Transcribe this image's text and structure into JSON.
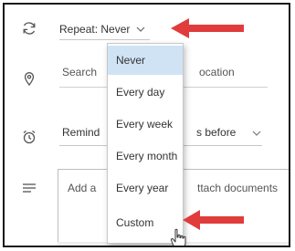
{
  "repeat": {
    "label": "Repeat: Never",
    "icon": "repeat-icon"
  },
  "location": {
    "left_text": "Search",
    "right_text": "ocation",
    "icon": "location-pin-icon"
  },
  "reminder": {
    "left_text": "Remind",
    "right_text": "s before",
    "icon": "alarm-clock-icon"
  },
  "notes": {
    "left_text": "Add a",
    "right_text": "ttach documents",
    "icon": "notes-lines-icon"
  },
  "repeat_menu": {
    "options": [
      "Never",
      "Every day",
      "Every week",
      "Every month",
      "Every year",
      "Custom"
    ],
    "selected": "Never"
  },
  "colors": {
    "accent_arrow": "#e03c3c",
    "selected_bg": "#cfe3f5"
  }
}
